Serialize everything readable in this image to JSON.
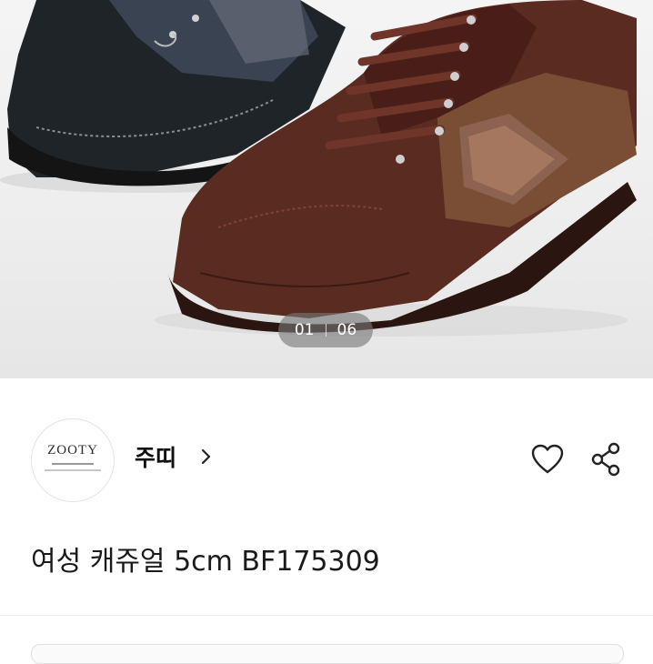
{
  "gallery": {
    "current": "01",
    "total": "06"
  },
  "store": {
    "name": "주띠",
    "logo_text": "ZOOTY",
    "chevron_icon": "chevron-right-icon",
    "heart_icon": "heart-outline-icon",
    "share_icon": "share-icon"
  },
  "product": {
    "title": "여성 캐쥬얼 5cm BF175309"
  }
}
